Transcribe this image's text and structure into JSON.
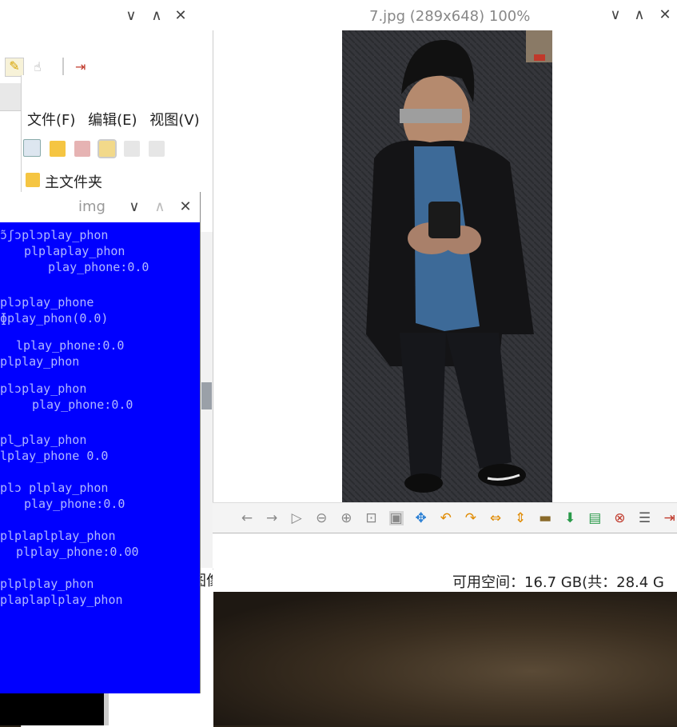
{
  "file_manager": {
    "menu": [
      "文件(F)",
      "编辑(E)",
      "视图(V)"
    ],
    "location": "主文件夹",
    "status_left": "图像",
    "title_controls": [
      "∨",
      "∧",
      "✕"
    ]
  },
  "img_window": {
    "title": "img",
    "title_controls": [
      "∨",
      "∧",
      "✕"
    ],
    "noise_lines": [
      "ɔ̃ʃɔplɔplay_phon",
      "plplaplay_phon",
      "play_phone:0.0",
      "plɔplay_phone",
      "ɸplay_phon(0.0)",
      "lplay_phone:0.0",
      "plplay_phon",
      "plɔplay_phon",
      "play_phone:0.0",
      "pl‿play_phon",
      "lplay_phone 0.0",
      "plɔ plplay_phon",
      "play_phone:0.0",
      "plplaplplay_phon",
      "plplay_phone:0.00",
      "plplplay_phon",
      "plaplaplplay_phon"
    ]
  },
  "viewer": {
    "title": "7.jpg (289x648) 100%",
    "title_controls": [
      "∨",
      "∧",
      "✕"
    ],
    "free_space": "可用空间：16.7 GB(共：28.4 G"
  },
  "colors": {
    "img_bg": "#0000ff",
    "photo_bg": "#2e2f33"
  }
}
